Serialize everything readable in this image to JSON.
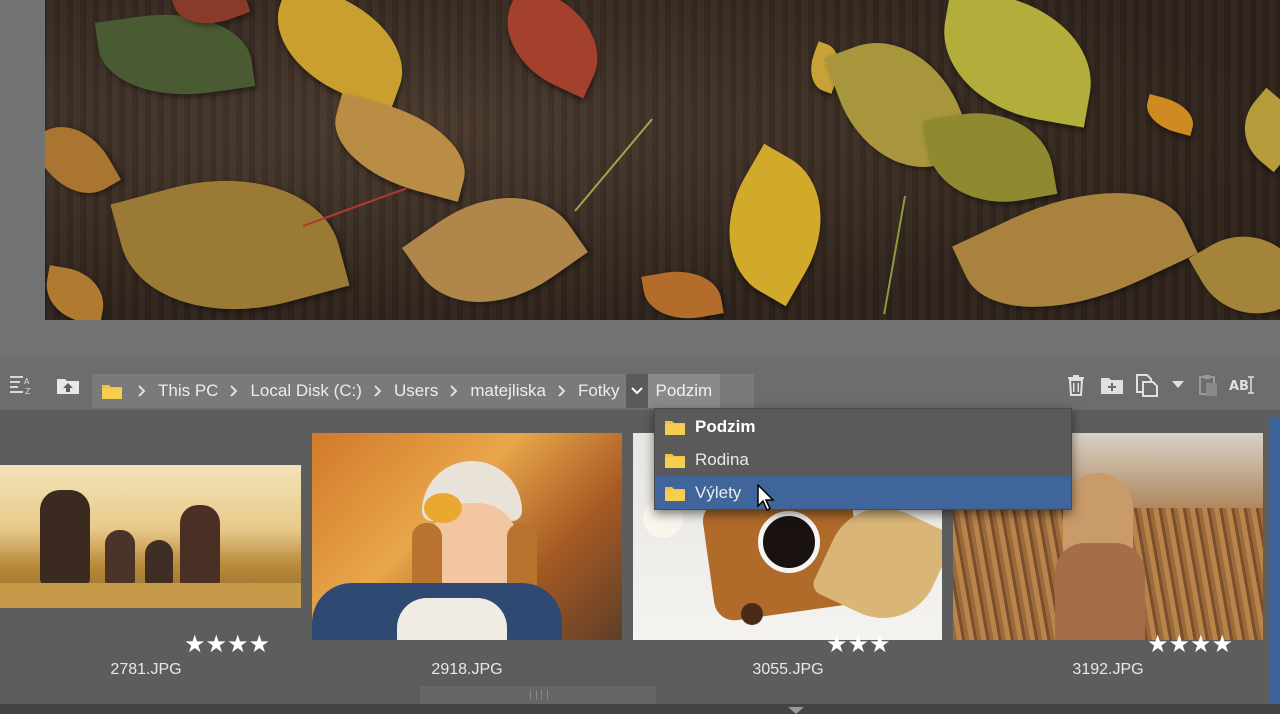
{
  "breadcrumb": {
    "segments": [
      "This PC",
      "Local Disk (C:)",
      "Users",
      "matejliska",
      "Fotky"
    ],
    "current": "Podzim"
  },
  "dropdown": {
    "items": [
      {
        "label": "Podzim",
        "bold": true
      },
      {
        "label": "Rodina",
        "bold": false
      },
      {
        "label": "Výlety",
        "selected": true
      }
    ]
  },
  "thumbnails": [
    {
      "filename": "2781.JPG",
      "stars": "★★★★"
    },
    {
      "filename": "2918.JPG",
      "stars": ""
    },
    {
      "filename": "3055.JPG",
      "stars": "★★★"
    },
    {
      "filename": "3192.JPG",
      "stars": "★★★★"
    }
  ],
  "toolbar": {
    "icons": [
      "sort-icon",
      "parent-folder-icon",
      "delete-icon",
      "new-folder-icon",
      "copy-icon",
      "paste-icon",
      "rename-icon"
    ]
  },
  "colors": {
    "accent": "#40659b",
    "folder": "#f5c13a"
  }
}
